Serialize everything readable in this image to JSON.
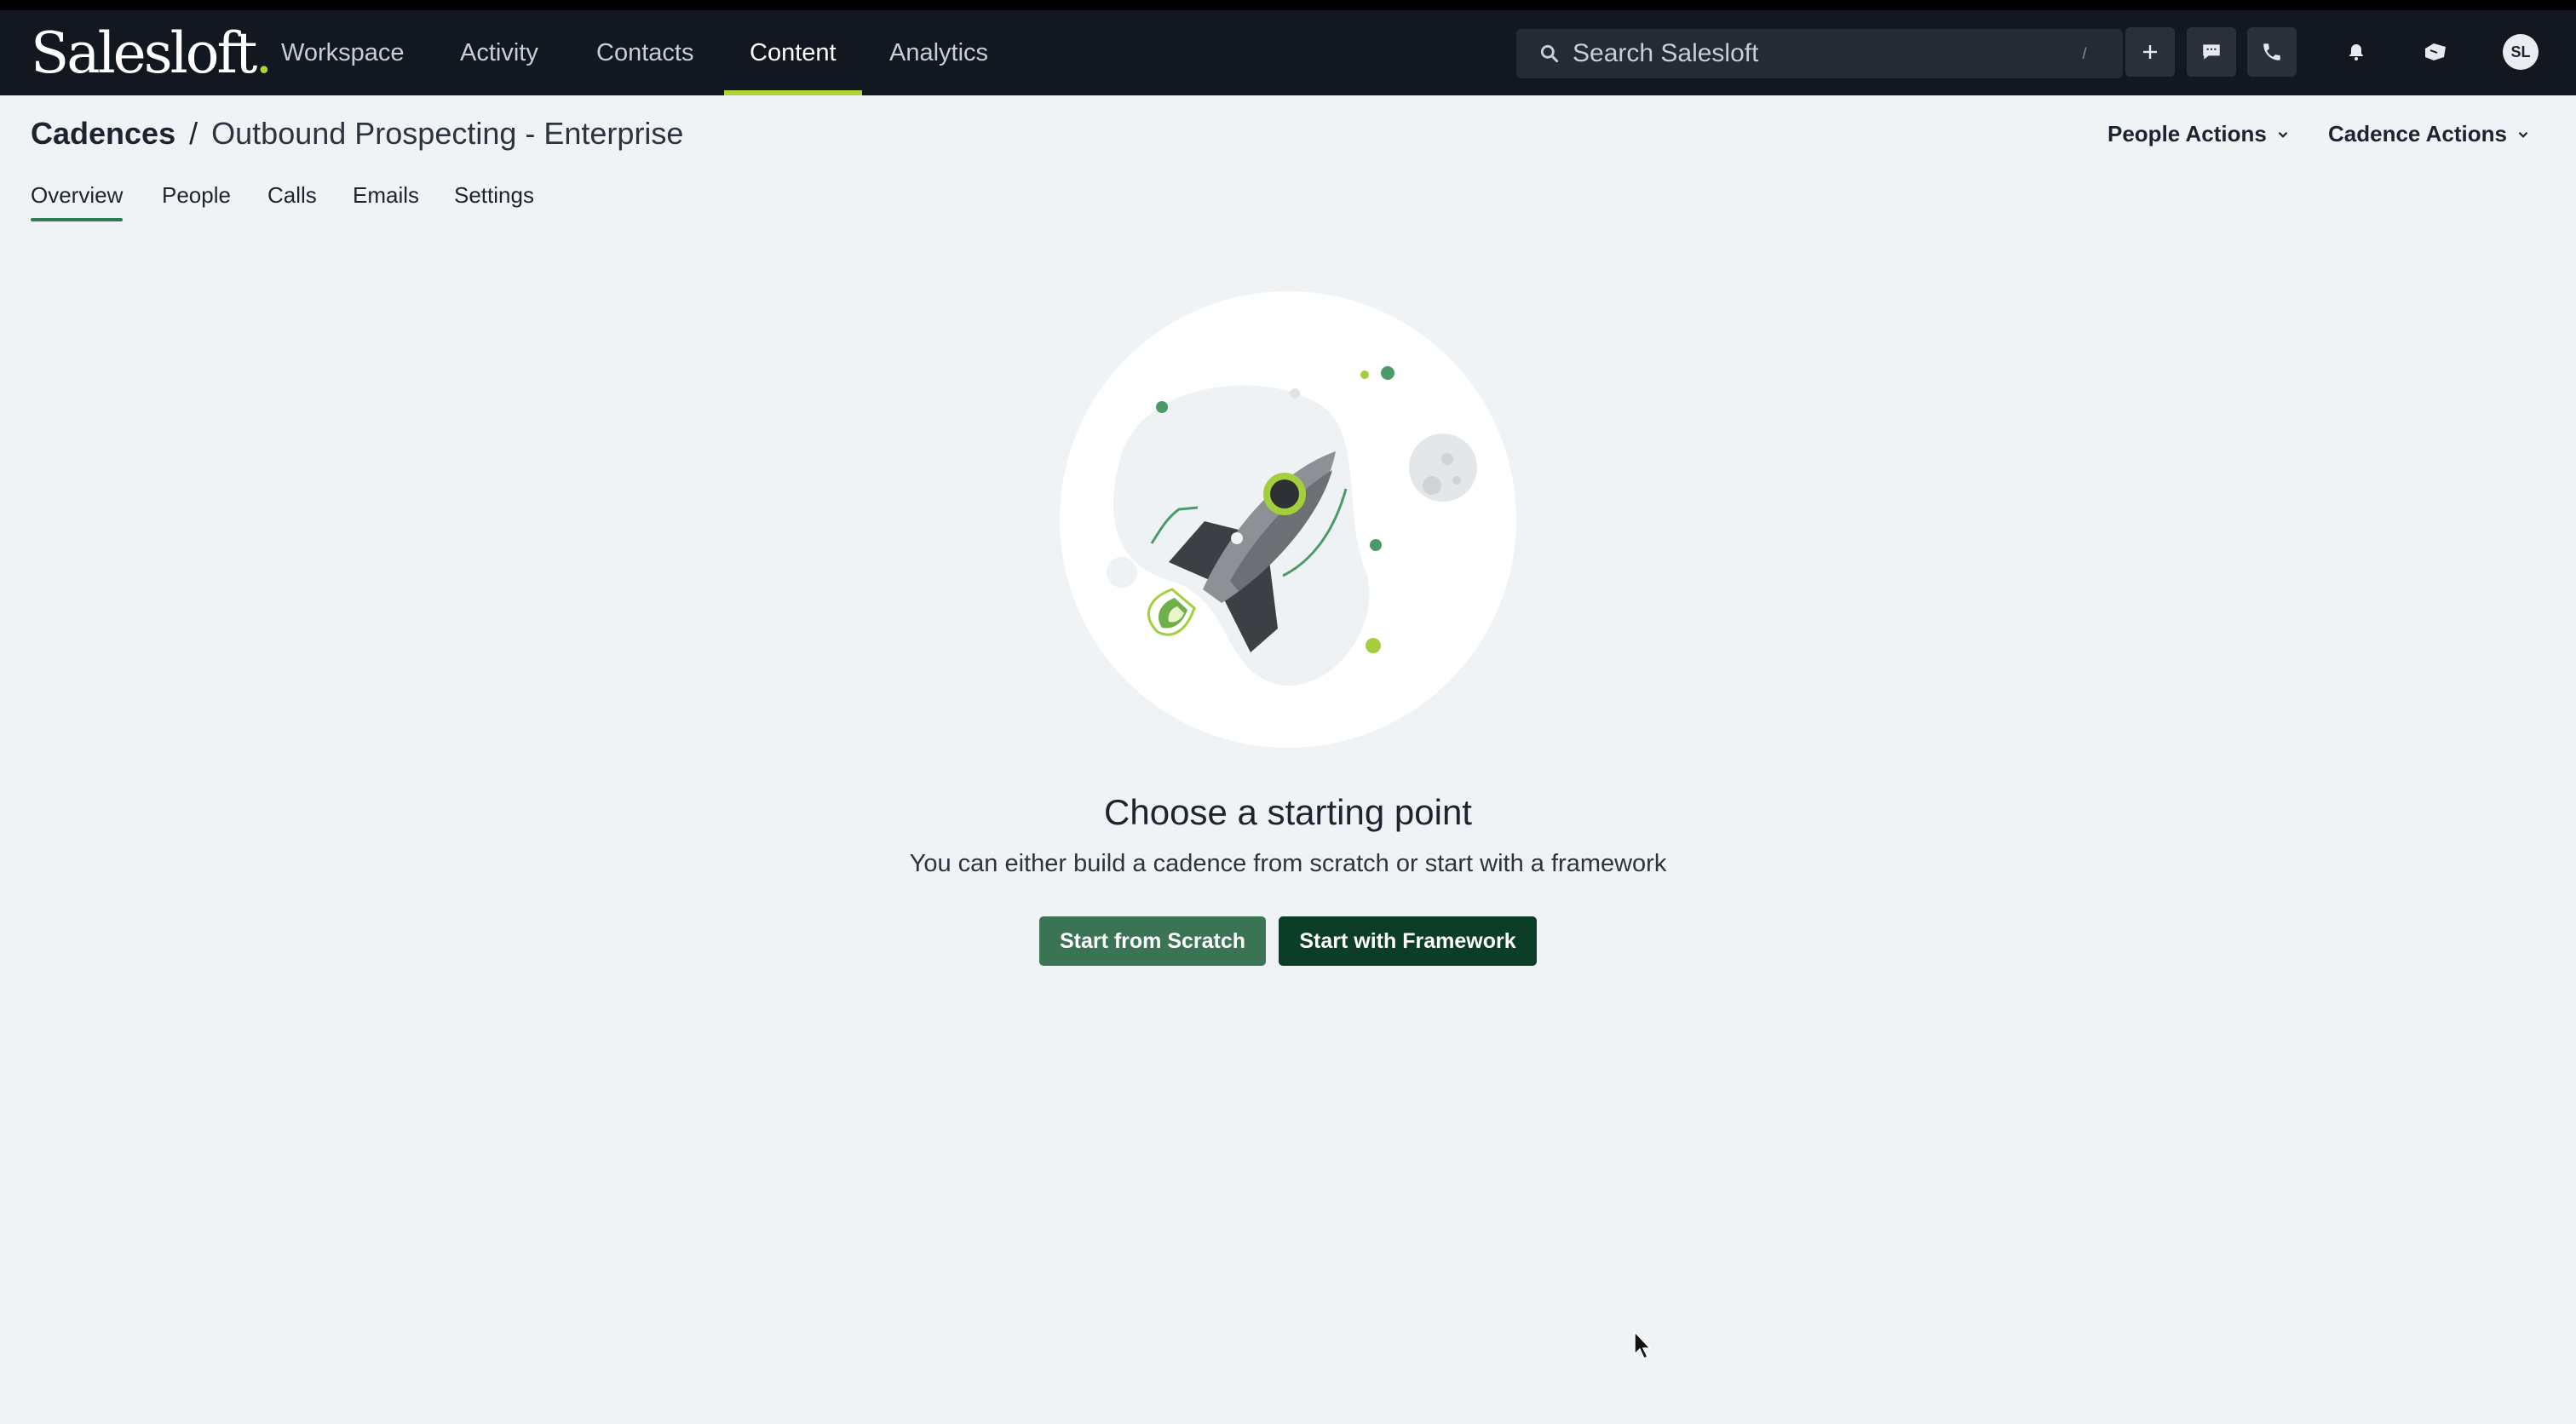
{
  "app": {
    "logo_text": "Salesloft",
    "logo_dot": ".",
    "accent_color": "#b4d335"
  },
  "nav": {
    "items": [
      {
        "label": "Workspace",
        "active": false
      },
      {
        "label": "Activity",
        "active": false
      },
      {
        "label": "Contacts",
        "active": false
      },
      {
        "label": "Content",
        "active": true
      },
      {
        "label": "Analytics",
        "active": false
      }
    ]
  },
  "search": {
    "placeholder": "Search Salesloft",
    "shortcut": "/"
  },
  "toolbar_icons": [
    "plus-icon",
    "chat-icon",
    "phone-icon",
    "bell-icon",
    "tasks-icon"
  ],
  "user": {
    "initials": "SL"
  },
  "breadcrumb": {
    "root": "Cadences",
    "separator": "/",
    "title": "Outbound Prospecting - Enterprise"
  },
  "actions": {
    "people_actions": "People Actions",
    "cadence_actions": "Cadence Actions"
  },
  "tabs": [
    {
      "label": "Overview",
      "active": true
    },
    {
      "label": "People",
      "active": false
    },
    {
      "label": "Calls",
      "active": false
    },
    {
      "label": "Emails",
      "active": false
    },
    {
      "label": "Settings",
      "active": false
    }
  ],
  "empty_state": {
    "headline": "Choose a starting point",
    "description": "You can either build a cadence from scratch or start with a framework",
    "primary_button": "Start from Scratch",
    "secondary_button": "Start with Framework"
  },
  "colors": {
    "nav_bg": "#131820",
    "page_bg": "#f0f3f6",
    "button_scratch": "#3b7355",
    "button_framework": "#0b3d27",
    "tab_underline": "#2f7a52"
  }
}
